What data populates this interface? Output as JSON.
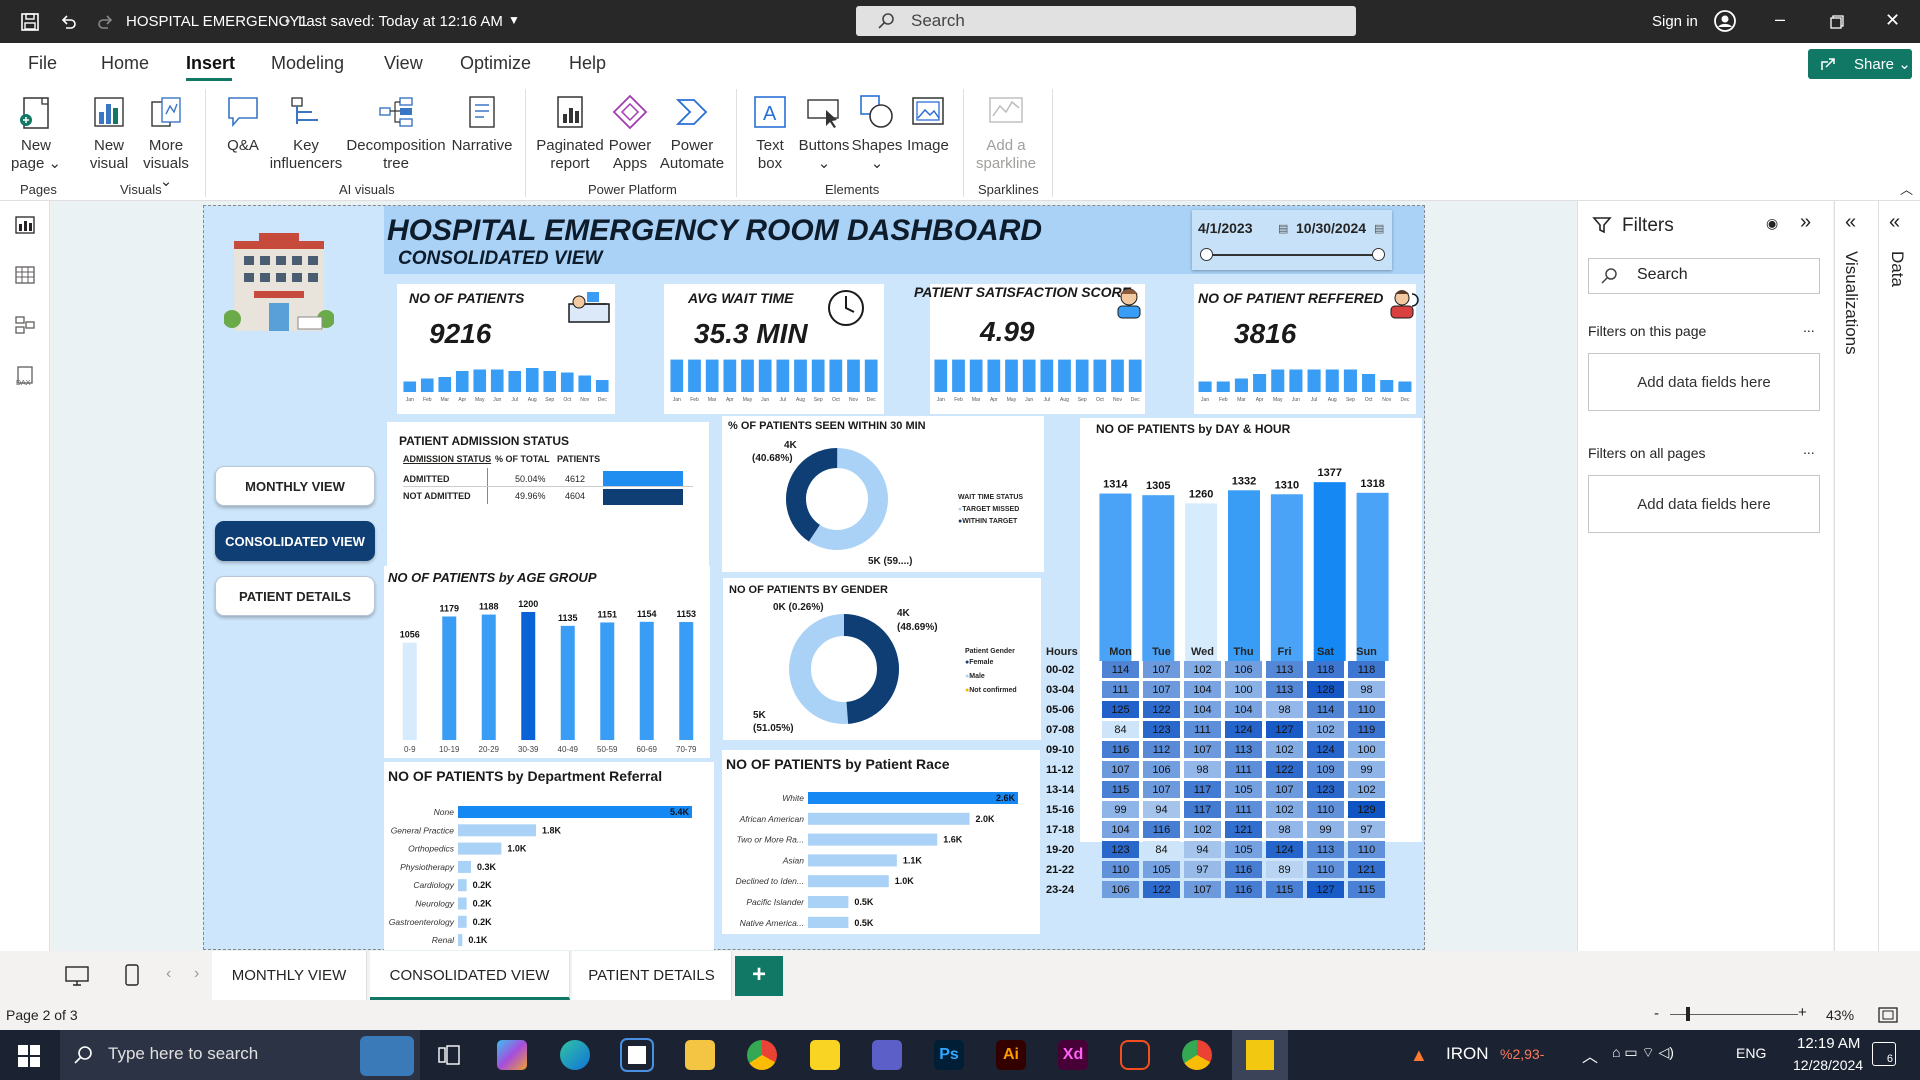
{
  "app": {
    "title": "HOSPITAL EMERGENCY1",
    "saved": "Last saved: Today at 12:16 AM",
    "search_placeholder": "Search",
    "sign_in": "Sign in"
  },
  "menu": {
    "items": [
      "File",
      "Home",
      "Insert",
      "Modeling",
      "View",
      "Optimize",
      "Help"
    ],
    "active": "Insert",
    "share": "Share"
  },
  "ribbon": {
    "buttons": [
      {
        "l1": "New",
        "l2": "page ⌄",
        "icon": "new-page-icon"
      },
      {
        "l1": "New",
        "l2": "visual",
        "icon": "new-visual-icon"
      },
      {
        "l1": "More",
        "l2": "visuals ⌄",
        "icon": "more-visuals-icon"
      },
      {
        "l1": "Q&A",
        "l2": "",
        "icon": "qa-icon"
      },
      {
        "l1": "Key",
        "l2": "influencers",
        "icon": "key-influencers-icon"
      },
      {
        "l1": "Decomposition",
        "l2": "tree",
        "icon": "decomposition-tree-icon"
      },
      {
        "l1": "Narrative",
        "l2": "",
        "icon": "narrative-icon"
      },
      {
        "l1": "Paginated",
        "l2": "report",
        "icon": "paginated-report-icon"
      },
      {
        "l1": "Power",
        "l2": "Apps",
        "icon": "power-apps-icon"
      },
      {
        "l1": "Power",
        "l2": "Automate",
        "icon": "power-automate-icon"
      },
      {
        "l1": "Text",
        "l2": "box",
        "icon": "text-box-icon"
      },
      {
        "l1": "Buttons",
        "l2": "⌄",
        "icon": "buttons-icon"
      },
      {
        "l1": "Shapes",
        "l2": "⌄",
        "icon": "shapes-icon"
      },
      {
        "l1": "Image",
        "l2": "",
        "icon": "image-icon"
      },
      {
        "l1": "Add a",
        "l2": "sparkline",
        "icon": "sparkline-icon"
      }
    ],
    "groups": [
      "Pages",
      "Visuals",
      "AI visuals",
      "Power Platform",
      "Elements",
      "Sparklines"
    ]
  },
  "report": {
    "title": "HOSPITAL EMERGENCY  ROOM DASHBOARD",
    "subtitle": "CONSOLIDATED VIEW",
    "date_from": "4/1/2023",
    "date_to": "10/30/2024",
    "nav": [
      "MONTHLY VIEW",
      "CONSOLIDATED VIEW",
      "PATIENT DETAILS"
    ],
    "months": [
      "Jan",
      "Feb",
      "Mar",
      "Apr",
      "May",
      "Jun",
      "Jul",
      "Aug",
      "Sep",
      "Oct",
      "Nov",
      "Dec"
    ],
    "kpis": [
      {
        "title": "NO OF PATIENTS",
        "value": "9216",
        "icon": "patient-bed-icon",
        "spark": [
          0.35,
          0.45,
          0.5,
          0.7,
          0.75,
          0.75,
          0.7,
          0.8,
          0.7,
          0.65,
          0.55,
          0.4
        ]
      },
      {
        "title": "AVG WAIT TIME",
        "value": "35.3 MIN",
        "icon": "clock-icon",
        "spark": [
          0.9,
          0.9,
          0.9,
          0.9,
          0.9,
          0.9,
          0.9,
          0.9,
          0.9,
          0.9,
          0.9,
          0.9
        ]
      },
      {
        "title": "PATIENT SATISFACTION SCORE",
        "value": "4.99",
        "icon": "nurse-icon",
        "spark": [
          0.9,
          0.9,
          0.9,
          0.9,
          0.9,
          0.9,
          0.9,
          0.9,
          0.9,
          0.9,
          0.9,
          0.9
        ]
      },
      {
        "title": "NO OF PATIENT REFFERED",
        "value": "3816",
        "icon": "doctor-icon",
        "spark": [
          0.35,
          0.35,
          0.45,
          0.6,
          0.75,
          0.75,
          0.75,
          0.75,
          0.75,
          0.6,
          0.4,
          0.35
        ]
      }
    ],
    "admission": {
      "title": "PATIENT ADMISSION STATUS",
      "headers": [
        "ADMISSION STATUS",
        "% OF TOTAL",
        "PATIENTS"
      ],
      "rows": [
        {
          "status": "ADMITTED",
          "pct": "50.04%",
          "patients": "4612",
          "share": 0.5004
        },
        {
          "status": "NOT ADMITTED",
          "pct": "49.96%",
          "patients": "4604",
          "share": 0.4996
        }
      ]
    },
    "wait30": {
      "title": "% OF PATIENTS SEEN WITHIN 30 MIN",
      "label_a": "4K",
      "label_a2": "(40.68%)",
      "label_b": "5K (59....)",
      "legend_title": "WAIT TIME STATUS",
      "legend": [
        "TARGET MISSED",
        "WITHIN TARGET"
      ]
    },
    "gender": {
      "title": "NO OF PATIENTS BY GENDER",
      "label_nc": "0K (0.26%)",
      "label_m1": "4K",
      "label_m2": "(48.69%)",
      "label_f1": "5K",
      "label_f2": "(51.05%)",
      "legend_title": "Patient Gender",
      "legend": [
        "Female",
        "Male",
        "Not confirmed"
      ]
    },
    "daytitle": "NO OF PATIENTS by DAY & HOUR",
    "heat": {
      "hours_label": "Hours",
      "days": [
        "Mon",
        "Tue",
        "Wed",
        "Thu",
        "Fri",
        "Sat",
        "Sun"
      ],
      "rows": [
        {
          "h": "00-02",
          "v": [
            114,
            107,
            102,
            106,
            113,
            118,
            118
          ]
        },
        {
          "h": "03-04",
          "v": [
            111,
            107,
            104,
            100,
            113,
            128,
            98
          ]
        },
        {
          "h": "05-06",
          "v": [
            125,
            122,
            104,
            104,
            98,
            114,
            110
          ]
        },
        {
          "h": "07-08",
          "v": [
            84,
            123,
            111,
            124,
            127,
            102,
            119
          ]
        },
        {
          "h": "09-10",
          "v": [
            116,
            112,
            107,
            113,
            102,
            124,
            100
          ]
        },
        {
          "h": "11-12",
          "v": [
            107,
            106,
            98,
            111,
            122,
            109,
            99
          ]
        },
        {
          "h": "13-14",
          "v": [
            115,
            107,
            117,
            105,
            107,
            123,
            102
          ]
        },
        {
          "h": "15-16",
          "v": [
            99,
            94,
            117,
            111,
            102,
            110,
            129
          ]
        },
        {
          "h": "17-18",
          "v": [
            104,
            116,
            102,
            121,
            98,
            99,
            97
          ]
        },
        {
          "h": "19-20",
          "v": [
            123,
            84,
            94,
            105,
            124,
            113,
            110
          ]
        },
        {
          "h": "21-22",
          "v": [
            110,
            105,
            97,
            116,
            89,
            110,
            121
          ]
        },
        {
          "h": "23-24",
          "v": [
            106,
            122,
            107,
            116,
            115,
            127,
            115
          ]
        }
      ]
    },
    "age_title": "NO OF PATIENTS by AGE GROUP",
    "dept_title": "NO OF PATIENTS by Department Referral",
    "race_title": "NO OF PATIENTS by Patient Race"
  },
  "chart_data": [
    {
      "type": "bar",
      "title": "NO OF PATIENTS by DAY & HOUR",
      "categories": [
        "Mon",
        "Tue",
        "Wed",
        "Thu",
        "Fri",
        "Sat",
        "Sun"
      ],
      "values": [
        1314,
        1305,
        1260,
        1332,
        1310,
        1377,
        1318
      ],
      "labels": [
        "1314",
        "1305",
        "1260",
        "1332",
        "1310",
        "1377",
        "1318"
      ]
    },
    {
      "type": "bar",
      "title": "NO OF PATIENTS by AGE GROUP",
      "categories": [
        "0-9",
        "10-19",
        "20-29",
        "30-39",
        "40-49",
        "50-59",
        "60-69",
        "70-79"
      ],
      "values": [
        1056,
        1179,
        1188,
        1200,
        1135,
        1151,
        1154,
        1153
      ],
      "labels": [
        "1056",
        "1179",
        "1188",
        "1200",
        "1135",
        "1151",
        "1154",
        "1153"
      ]
    },
    {
      "type": "bar",
      "title": "NO OF PATIENTS by Department Referral",
      "categories": [
        "None",
        "General Practice",
        "Orthopedics",
        "Physiotherapy",
        "Cardiology",
        "Neurology",
        "Gastroenterology",
        "Renal"
      ],
      "values": [
        5.4,
        1.8,
        1.0,
        0.3,
        0.2,
        0.2,
        0.2,
        0.1
      ],
      "labels": [
        "5.4K",
        "1.8K",
        "1.0K",
        "0.3K",
        "0.2K",
        "0.2K",
        "0.2K",
        "0.1K"
      ]
    },
    {
      "type": "bar",
      "title": "NO OF PATIENTS by Patient Race",
      "categories": [
        "White",
        "African American",
        "Two or More Ra...",
        "Asian",
        "Declined to Iden...",
        "Pacific Islander",
        "Native America..."
      ],
      "values": [
        2.6,
        2.0,
        1.6,
        1.1,
        1.0,
        0.5,
        0.5
      ],
      "labels": [
        "2.6K",
        "2.0K",
        "1.6K",
        "1.1K",
        "1.0K",
        "0.5K",
        "0.5K"
      ]
    },
    {
      "type": "pie",
      "title": "% OF PATIENTS SEEN WITHIN 30 MIN",
      "categories": [
        "TARGET MISSED",
        "WITHIN TARGET"
      ],
      "values": [
        59.32,
        40.68
      ]
    },
    {
      "type": "pie",
      "title": "NO OF PATIENTS BY GENDER",
      "categories": [
        "Female",
        "Male",
        "Not confirmed"
      ],
      "values": [
        51.05,
        48.69,
        0.26
      ]
    }
  ],
  "filters": {
    "title": "Filters",
    "search": "Search",
    "this_page": "Filters on this page",
    "all_pages": "Filters on all pages",
    "add": "Add data fields here",
    "more": "..."
  },
  "sidepanes": {
    "viz": "Visualizations",
    "data": "Data"
  },
  "tabs": [
    "MONTHLY VIEW",
    "CONSOLIDATED VIEW",
    "PATIENT DETAILS"
  ],
  "status": {
    "page": "Page 2 of 3",
    "zoom": "43%"
  },
  "taskbar": {
    "search": "Type here to search",
    "weather": "IRON",
    "weather2": "%2,93-",
    "lang": "ENG",
    "time": "12:19 AM",
    "date": "12/28/2024",
    "notif": "6"
  },
  "colors": {
    "accent": "#117865",
    "bar": "#3a9df5",
    "bar_dark": "#0a63d6",
    "bar_light": "#d6ecfd",
    "navy": "#0e3e73",
    "donut_light": "#a9d2f6"
  }
}
